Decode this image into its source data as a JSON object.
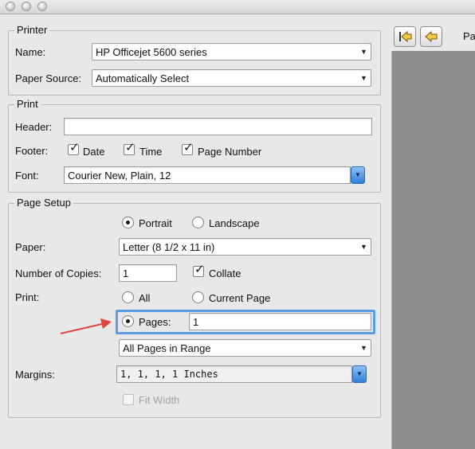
{
  "printer": {
    "title": "Printer",
    "name_label": "Name:",
    "name_value": "HP Officejet 5600 series",
    "paper_source_label": "Paper Source:",
    "paper_source_value": "Automatically Select"
  },
  "print": {
    "title": "Print",
    "header_label": "Header:",
    "header_value": "",
    "footer_label": "Footer:",
    "footer_date": "Date",
    "footer_time": "Time",
    "footer_page_number": "Page Number",
    "footer_date_checked": true,
    "footer_time_checked": true,
    "footer_page_number_checked": true,
    "font_label": "Font:",
    "font_value": "Courier New, Plain, 12"
  },
  "page_setup": {
    "title": "Page Setup",
    "orientation": {
      "portrait": "Portrait",
      "landscape": "Landscape",
      "selected": "portrait"
    },
    "paper_label": "Paper:",
    "paper_value": "Letter (8 1/2 x 11 in)",
    "copies_label": "Number of Copies:",
    "copies_value": "1",
    "collate_label": "Collate",
    "collate_checked": true,
    "print_label": "Print:",
    "range": {
      "all": "All",
      "current_page": "Current Page",
      "pages": "Pages:",
      "pages_value": "1",
      "selected": "pages"
    },
    "range_filter_value": "All Pages in Range",
    "margins_label": "Margins:",
    "margins_value": "1, 1, 1, 1 Inches",
    "fit_width_label": "Fit Width",
    "fit_width_checked": false
  },
  "preview": {
    "page_label": "Pa"
  },
  "icons": {
    "first_page": "first-page-icon",
    "prev_page": "prev-page-icon"
  },
  "colors": {
    "focus": "#5b9ee6",
    "annotation_arrow": "#e0443a",
    "accent_button": "#2f7fd9"
  }
}
